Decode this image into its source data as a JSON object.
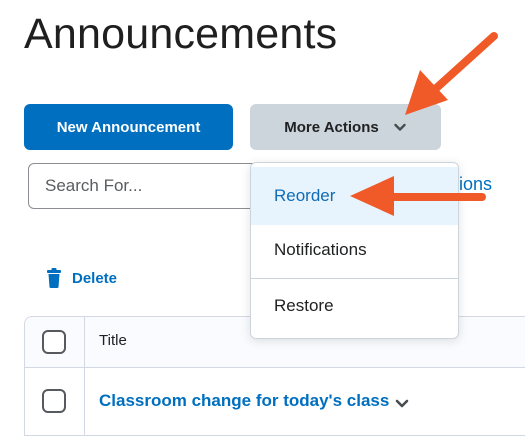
{
  "page": {
    "title": "Announcements"
  },
  "toolbar": {
    "new_label": "New Announcement",
    "more_label": "More Actions"
  },
  "search": {
    "placeholder": "Search For..."
  },
  "options_link": "ions",
  "bulk": {
    "delete_label": "Delete"
  },
  "table": {
    "header_title": "Title",
    "rows": [
      {
        "title": "Classroom change for today's class"
      }
    ]
  },
  "menu": {
    "items": [
      {
        "label": "Reorder",
        "state": "highlighted"
      },
      {
        "label": "Notifications"
      },
      {
        "label": "Restore"
      }
    ]
  },
  "colors": {
    "primary": "#006fbf",
    "secondary_button": "#cdd5dc",
    "annotation_arrow": "#f05a28",
    "menu_highlight": "#e8f4fd"
  },
  "icons": [
    "chevron-down-icon",
    "trash-icon",
    "checkbox",
    "annotation-arrow"
  ]
}
